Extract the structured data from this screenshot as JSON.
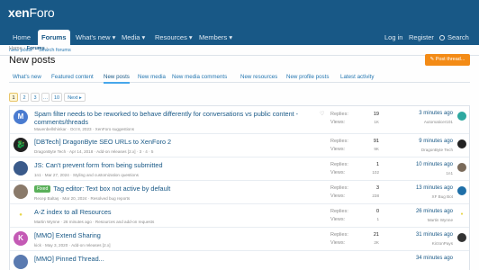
{
  "header": {
    "logo_x": "xen",
    "logo_rest": "Foro"
  },
  "nav": {
    "items": [
      "Home",
      "Forums",
      "What's new ▾",
      "Media ▾",
      "Resources ▾",
      "Members ▾"
    ],
    "login": "Log in",
    "register": "Register",
    "search": "Search"
  },
  "subnav": {
    "new_posts": "New posts",
    "search_forums": "Search forums"
  },
  "breadcrumb": {
    "home": "Home",
    "sep": "›",
    "forums": "Forums",
    "sep2": "›"
  },
  "page": {
    "title": "New posts",
    "post_thread": "Post thread..."
  },
  "tabs": [
    "What's new",
    "Featured content",
    "New posts",
    "New media",
    "New media comments",
    "New resources",
    "New profile posts",
    "Latest activity"
  ],
  "pager": {
    "pages": [
      "1",
      "2",
      "3",
      "…",
      "10"
    ],
    "next": "Next ▸"
  },
  "labels": {
    "replies": "Replies:",
    "views": "Views:"
  },
  "threads": [
    {
      "avatar_letter": "M",
      "avatar_color": "#4a7bd0",
      "title": "Spam filter needs to be reworked to behave differently for conversations vs public content -",
      "title2": "comments/threads",
      "meta": "Mavenbellshinkar · Oct 8, 2023 · XenForo suggestions",
      "replies": "19",
      "views": "1K",
      "time": "3 minutes ago",
      "last_user": "Automaticer101",
      "last_color": "#2ea8a0"
    },
    {
      "avatar_letter": "",
      "avatar_color": "#222222",
      "title": "[DBTech] DragonByte SEO URLs to XenForo 2",
      "meta": "DragonByte Tech · Apr 14, 2018 · Add-on releases [2.x] · 3 · 4 · 5",
      "replies": "91",
      "views": "9K",
      "time": "9 minutes ago",
      "last_user": "DragonByte Tech",
      "last_color": "#222222"
    },
    {
      "avatar_letter": "",
      "avatar_color": "#3a5a8a",
      "title": "JS: Can't prevent form from being submitted",
      "meta": "1n1 · Mar 27, 2024 · Styling and customization questions",
      "replies": "1",
      "views": "102",
      "time": "10 minutes ago",
      "last_user": "1n1",
      "last_color": "#7a6a5a"
    },
    {
      "avatar_letter": "",
      "avatar_color": "#8a7a6a",
      "prefix": "Fixed",
      "title": "Tag editor: Text box not active by default",
      "meta": "Recep Baltaş · Mar 20, 2024 · Resolved bug reports",
      "replies": "3",
      "views": "238",
      "time": "13 minutes ago",
      "last_user": "XF Bug Bot",
      "last_color": "#1e6fa8"
    },
    {
      "avatar_letter": "",
      "avatar_color": "#e8d64a",
      "title": "A-Z index to all Resources",
      "meta": "Martin Wynne · 26 minutes ago · Resources and add-on requests",
      "replies": "0",
      "views": "1",
      "time": "26 minutes ago",
      "last_user": "Martin Wynne",
      "last_color": "#e8d64a"
    },
    {
      "avatar_letter": "K",
      "avatar_color": "#c45ab5",
      "title": "[MMO] Extend Sharing",
      "meta": "kick · May 3, 2020 · Add-on releases [2.x]",
      "replies": "21",
      "views": "2K",
      "time": "31 minutes ago",
      "last_user": "KirzonPays",
      "last_color": "#333333"
    },
    {
      "avatar_letter": "",
      "avatar_color": "#5a7ab0",
      "title": "[MMO] Pinned Thread...",
      "meta": "",
      "replies": "",
      "views": "",
      "time": "34 minutes ago",
      "last_user": "",
      "last_color": "#5a7ab0"
    }
  ]
}
